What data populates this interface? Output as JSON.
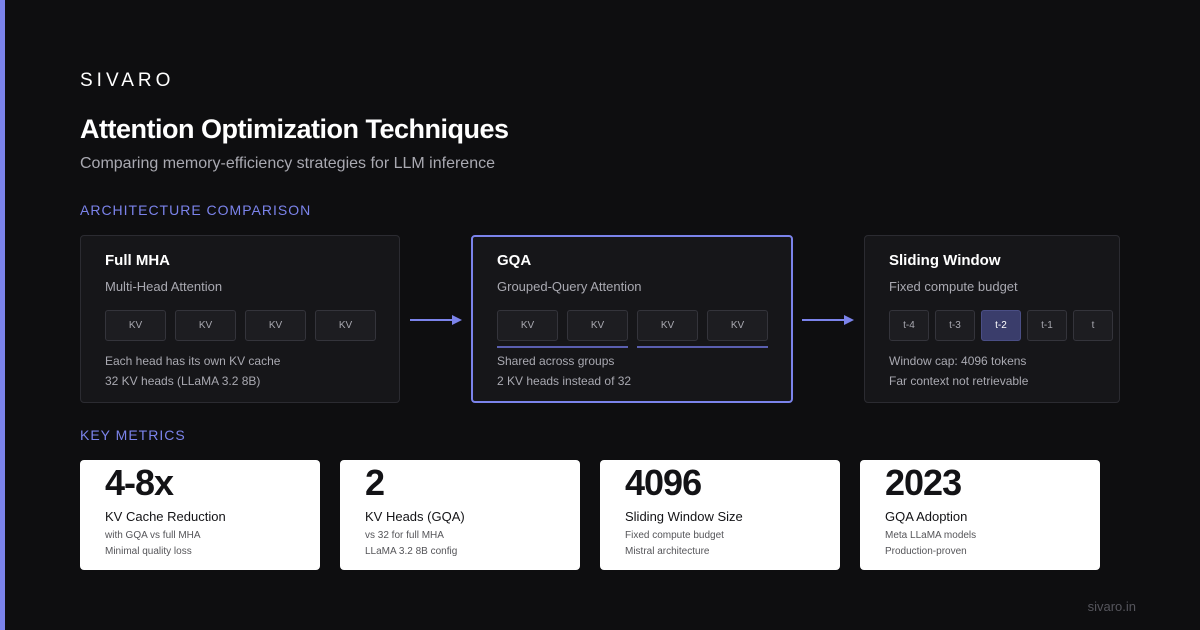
{
  "brand": "SIVARO",
  "title": "Attention Optimization Techniques",
  "subtitle": "Comparing memory-efficiency strategies for LLM inference",
  "sections": {
    "architecture": "ARCHITECTURE COMPARISON",
    "metrics": "KEY METRICS"
  },
  "cards": [
    {
      "title": "Full MHA",
      "subtitle": "Multi-Head Attention",
      "chips": [
        "KV",
        "KV",
        "KV",
        "KV"
      ],
      "notes": [
        "Each head has its own KV cache",
        "32 KV heads (LLaMA 3.2 8B)"
      ]
    },
    {
      "title": "GQA",
      "subtitle": "Grouped-Query Attention",
      "chips": [
        "KV",
        "KV",
        "KV",
        "KV"
      ],
      "notes": [
        "Shared across groups",
        "2 KV heads instead of 32"
      ]
    },
    {
      "title": "Sliding Window",
      "subtitle": "Fixed compute budget",
      "chips": [
        "t-4",
        "t-3",
        "t-2",
        "t-1",
        "t"
      ],
      "notes": [
        "Window cap: 4096 tokens",
        "Far context not retrievable"
      ]
    }
  ],
  "metrics": [
    {
      "value": "4-8x",
      "label": "KV Cache Reduction",
      "notes": [
        "with GQA vs full MHA",
        "Minimal quality loss"
      ]
    },
    {
      "value": "2",
      "label": "KV Heads (GQA)",
      "notes": [
        "vs 32 for full MHA",
        "LLaMA 3.2 8B config"
      ]
    },
    {
      "value": "4096",
      "label": "Sliding Window Size",
      "notes": [
        "Fixed compute budget",
        "Mistral architecture"
      ]
    },
    {
      "value": "2023",
      "label": "GQA Adoption",
      "notes": [
        "Meta LLaMA models",
        "Production-proven"
      ]
    }
  ],
  "footer": "sivaro.in",
  "colors": {
    "accent": "#7b83eb",
    "background": "#0e0e10",
    "card": "#161619",
    "active_chip": "#3a3d6b"
  }
}
